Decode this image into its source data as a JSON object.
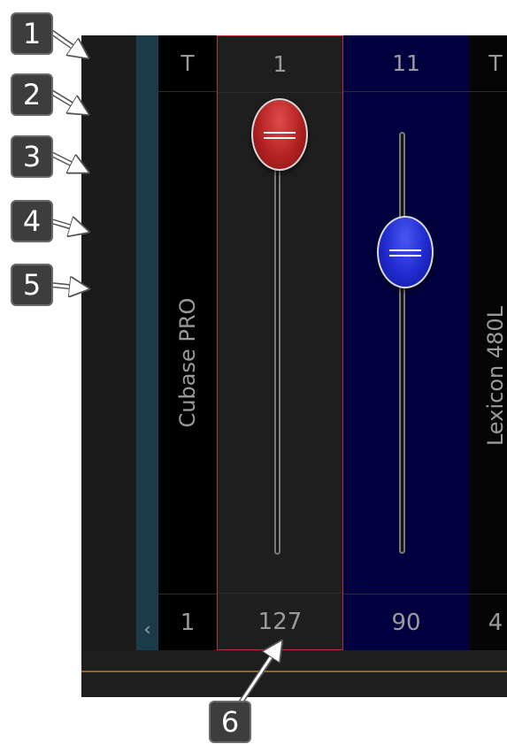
{
  "transport": {
    "buttons": [
      {
        "label": "1",
        "name": "go-to-start"
      },
      {
        "label": "2",
        "name": "rewind"
      },
      {
        "label": "3",
        "name": "record"
      },
      {
        "label": "4",
        "name": "fast-forward"
      },
      {
        "label": "5",
        "name": "go-to-end"
      }
    ]
  },
  "callout_6": "6",
  "channels": [
    {
      "header": "T",
      "value": "1",
      "device": "Cubase PRO"
    },
    {
      "header": "1",
      "value": "127",
      "fader_level": 1.0,
      "color": "#b32222"
    },
    {
      "header": "11",
      "value": "90",
      "fader_level": 0.71,
      "color": "#1f2ad0"
    },
    {
      "header": "T",
      "value": "4",
      "device": "Lexicon 480L"
    }
  ],
  "scroll_left_glyph": "‹",
  "colors": {
    "transport_button": "#9b2228",
    "selected_border": "#b83038",
    "blue_channel_bg": "#00003e"
  }
}
